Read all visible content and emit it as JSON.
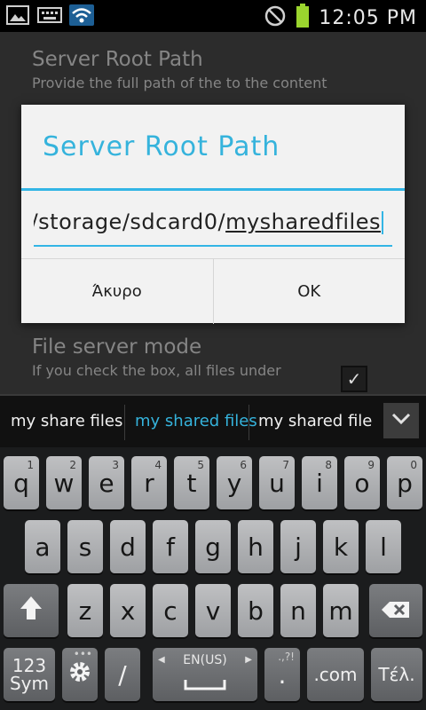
{
  "status": {
    "time": "12:05 PM"
  },
  "settings": {
    "item1_title": "Server Root Path",
    "item1_sub": "Provide the full path of the to the content",
    "item2_title": "File server mode",
    "item2_sub": "If you check the box, all files under",
    "item2_checked": true
  },
  "dialog": {
    "title": "Server Root Path",
    "input_prefix": "/storage/sdcard0/",
    "input_word": "mysharedfiles",
    "cancel": "Άκυρο",
    "ok": "OK"
  },
  "suggestions": [
    "my share files",
    "my shared files",
    "my shared file"
  ],
  "keyboard": {
    "row1": [
      {
        "k": "q",
        "h": "1"
      },
      {
        "k": "w",
        "h": "2"
      },
      {
        "k": "e",
        "h": "3"
      },
      {
        "k": "r",
        "h": "4"
      },
      {
        "k": "t",
        "h": "5"
      },
      {
        "k": "y",
        "h": "6"
      },
      {
        "k": "u",
        "h": "7"
      },
      {
        "k": "i",
        "h": "8"
      },
      {
        "k": "o",
        "h": "9"
      },
      {
        "k": "p",
        "h": "0"
      }
    ],
    "row2": [
      "a",
      "s",
      "d",
      "f",
      "g",
      "h",
      "j",
      "k",
      "l"
    ],
    "row3": [
      "z",
      "x",
      "c",
      "v",
      "b",
      "n",
      "m"
    ],
    "sym": "123\nSym",
    "slash": "/",
    "space_lang": "EN(US)",
    "dot": ".",
    "dotcom": ".com",
    "done": "Τέλ."
  }
}
